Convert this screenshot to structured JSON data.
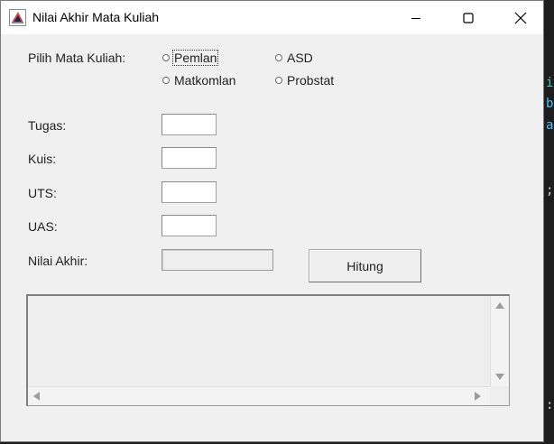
{
  "window": {
    "title": "Nilai Akhir Mata Kuliah",
    "controls": {
      "minimize": "minimize",
      "maximize": "maximize",
      "close": "close"
    }
  },
  "course": {
    "label": "Pilih Mata Kuliah:",
    "options": [
      {
        "label": "Pemlan",
        "selected": false,
        "focused": true
      },
      {
        "label": "ASD",
        "selected": false,
        "focused": false
      },
      {
        "label": "Matkomlan",
        "selected": false,
        "focused": false
      },
      {
        "label": "Probstat",
        "selected": false,
        "focused": false
      }
    ]
  },
  "scores": {
    "tugas": {
      "label": "Tugas:",
      "value": ""
    },
    "kuis": {
      "label": "Kuis:",
      "value": ""
    },
    "uts": {
      "label": "UTS:",
      "value": ""
    },
    "uas": {
      "label": "UAS:",
      "value": ""
    }
  },
  "result": {
    "label": "Nilai Akhir:",
    "value": ""
  },
  "actions": {
    "calculate_label": "Hitung"
  },
  "output": {
    "text": ""
  },
  "background_editor": {
    "glyphs": [
      "i",
      "b",
      "a",
      ";",
      ":"
    ],
    "colors": [
      "#4ec9b0",
      "#4fc1ff",
      "#4fc1ff",
      "#d4d4d4",
      "#d4d4d4"
    ]
  }
}
